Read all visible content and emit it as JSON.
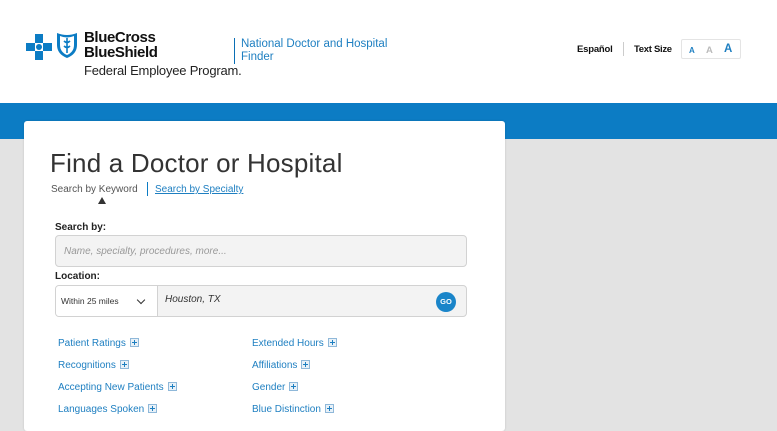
{
  "header": {
    "brand_line1": "BlueCross",
    "brand_line2": "BlueShield",
    "brand_line3": "Federal Employee Program.",
    "finder_title": "National Doctor and Hospital Finder",
    "espanol": "Español",
    "text_size_label": "Text Size",
    "text_size_options": [
      "A",
      "A",
      "A"
    ]
  },
  "main": {
    "title": "Find a Doctor or Hospital",
    "tabs": [
      {
        "label": "Search by Keyword",
        "active": true
      },
      {
        "label": "Search by Specialty",
        "active": false
      }
    ],
    "search": {
      "label": "Search by:",
      "placeholder": "Name, specialty, procedures, more...",
      "value": ""
    },
    "location": {
      "label": "Location:",
      "distance": "Within 25 miles",
      "value": "Houston, TX",
      "go_label": "GO"
    },
    "filters_left": [
      "Patient Ratings",
      "Recognitions",
      "Accepting New Patients",
      "Languages Spoken"
    ],
    "filters_right": [
      "Extended Hours",
      "Affiliations",
      "Gender",
      "Blue Distinction"
    ]
  },
  "colors": {
    "brand_blue": "#0c7cc4",
    "link_blue": "#1e7fc1",
    "background": "#e3e3e3"
  },
  "icons": [
    "bluecross-logo-icon",
    "blueshield-logo-icon",
    "chevron-down-icon",
    "plus-icon"
  ]
}
